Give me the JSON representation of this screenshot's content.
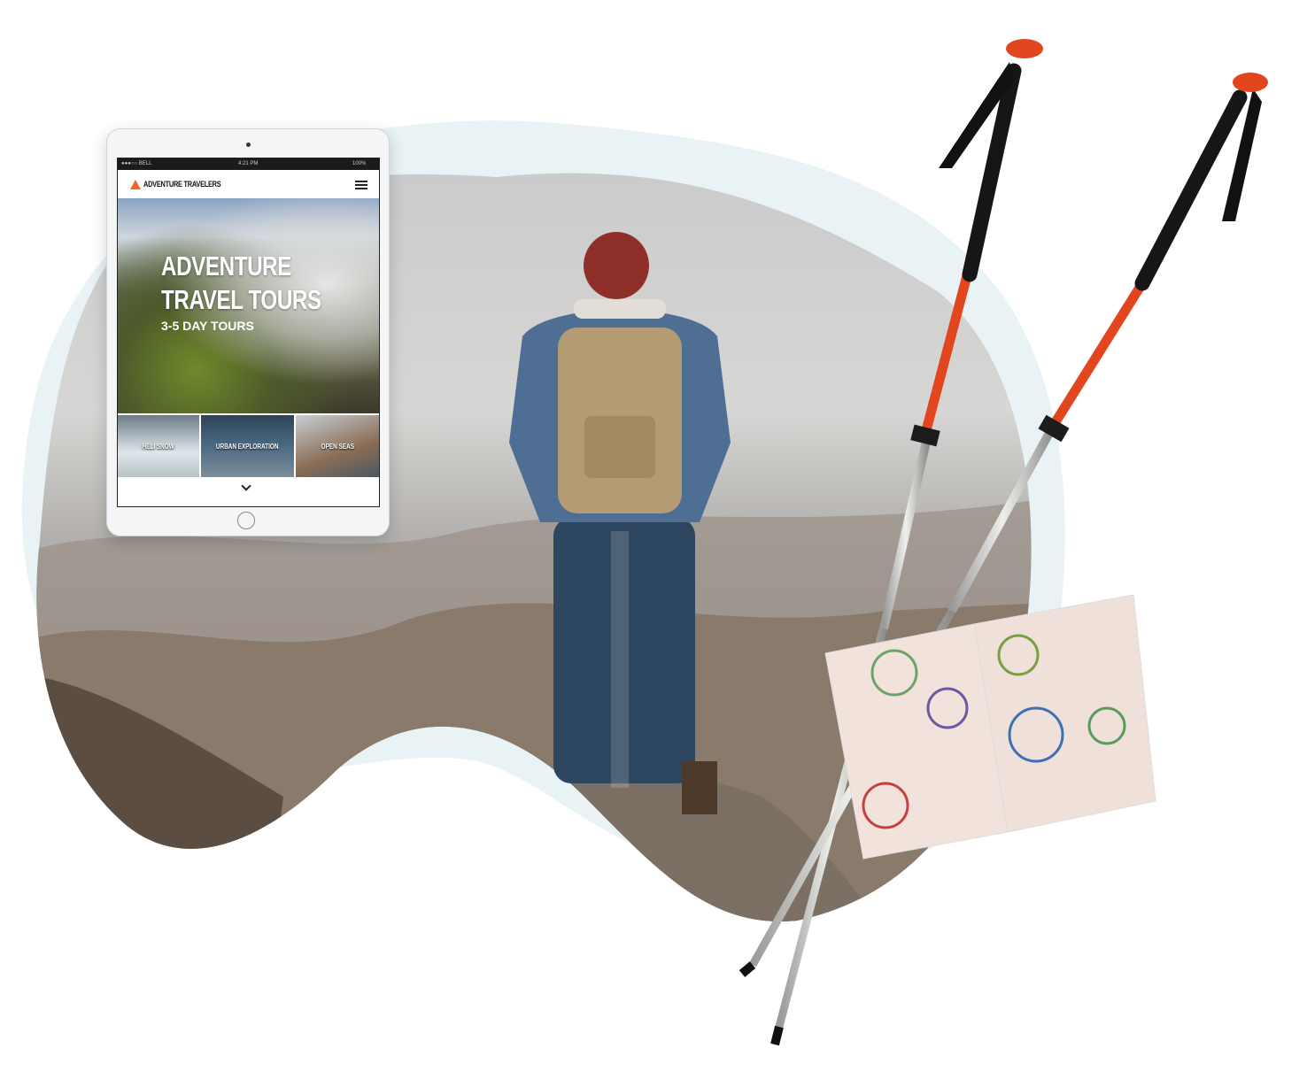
{
  "tablet": {
    "status_bar": {
      "carrier": "●●●○○ BELL",
      "time": "4:21 PM",
      "battery": "100%"
    },
    "header": {
      "brand": "ADVENTURE TRAVELERS",
      "logo_icon": "orange-triangle-icon",
      "menu_icon": "hamburger-icon"
    },
    "hero": {
      "title_line1": "ADVENTURE",
      "title_line2": "TRAVEL TOURS",
      "subtitle": "3-5 DAY TOURS"
    },
    "tiles": [
      {
        "label": "HELI SNOW"
      },
      {
        "label": "URBAN EXPLORATION"
      },
      {
        "label": "OPEN SEAS"
      }
    ],
    "scroll_icon": "chevron-down-icon"
  },
  "colors": {
    "accent": "#f26522",
    "blob": "#e8f3f6",
    "pole": "#e2461e"
  }
}
